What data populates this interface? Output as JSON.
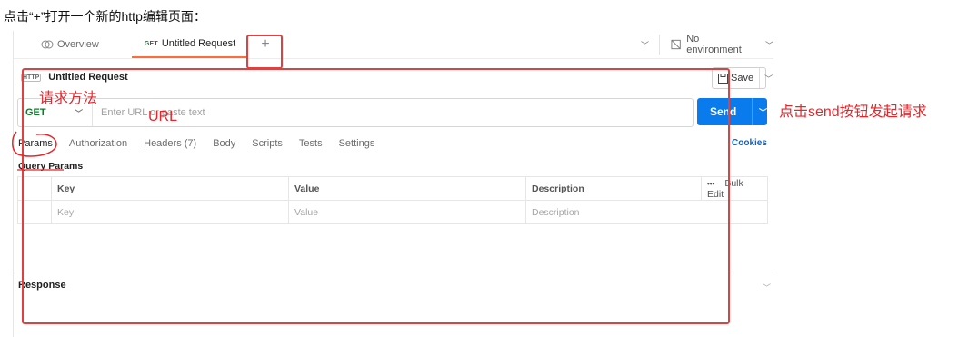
{
  "caption": "点击“+”打开一个新的http编辑页面：",
  "tabs": [
    {
      "label": "Overview"
    },
    {
      "method": "GET",
      "label": "Untitled Request"
    }
  ],
  "new_tab_icon": "+",
  "environment": {
    "label": "No environment"
  },
  "request": {
    "title": "Untitled Request",
    "http_icon": "HTTP",
    "save_label": "Save",
    "method": "GET",
    "url_placeholder": "Enter URL or paste text",
    "send_label": "Send"
  },
  "subtabs": [
    {
      "label": "Params",
      "active": true
    },
    {
      "label": "Authorization"
    },
    {
      "label": "Headers (7)"
    },
    {
      "label": "Body"
    },
    {
      "label": "Scripts"
    },
    {
      "label": "Tests"
    },
    {
      "label": "Settings"
    }
  ],
  "cookies_label": "Cookies",
  "query_params": {
    "title": "Query Params",
    "headers": [
      "Key",
      "Value",
      "Description"
    ],
    "bulk_edit": "Bulk Edit",
    "more": "•••",
    "placeholder_row": [
      "Key",
      "Value",
      "Description"
    ]
  },
  "response_label": "Response",
  "annotations": {
    "method": "请求方法",
    "url": "URL",
    "send": "点击send按钮发起请求"
  },
  "colors": {
    "accent_tab": "#ff6c37",
    "send": "#097bed",
    "get": "#0a7d29",
    "annotation": "#e5262b"
  }
}
